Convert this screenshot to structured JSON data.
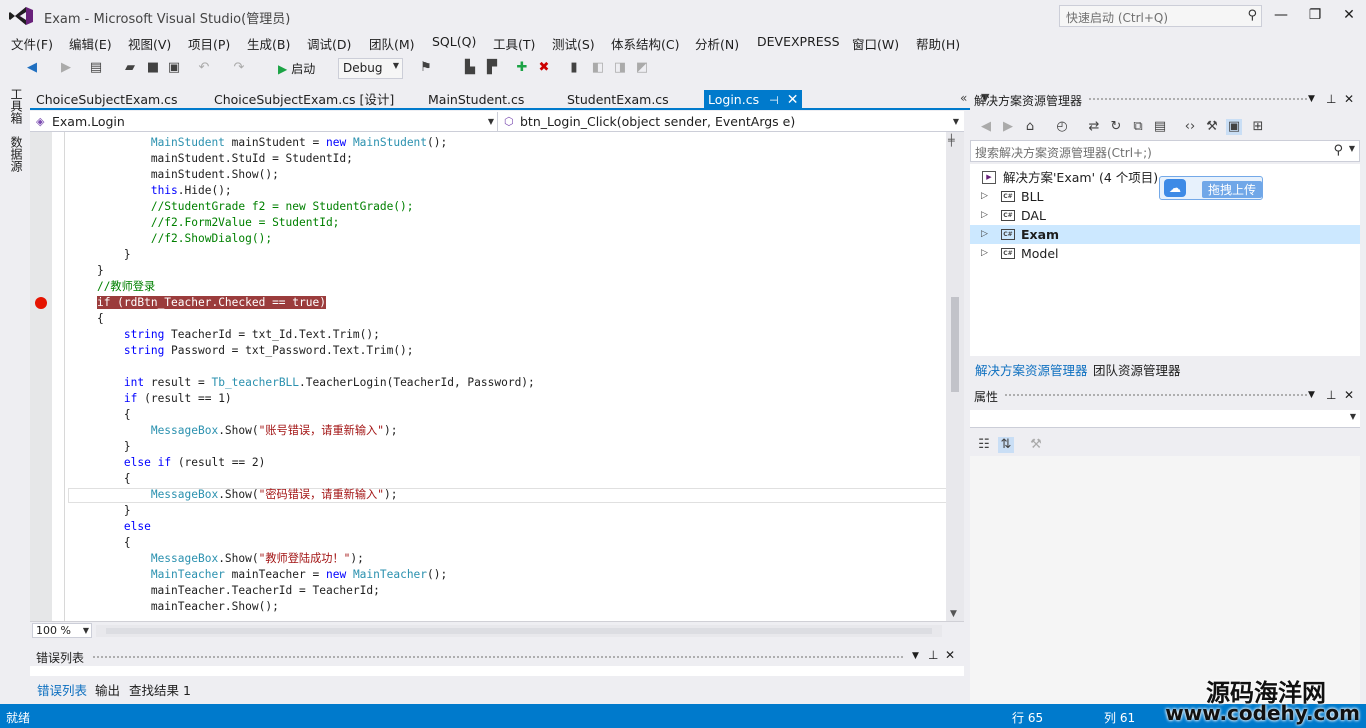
{
  "window": {
    "title": "Exam - Microsoft Visual Studio(管理员)",
    "quick_launch_placeholder": "快速启动 (Ctrl+Q)",
    "minimize": "—",
    "maximize": "❐",
    "close": "✕"
  },
  "menu": [
    "文件(F)",
    "编辑(E)",
    "视图(V)",
    "项目(P)",
    "生成(B)",
    "调试(D)",
    "团队(M)",
    "SQL(Q)",
    "工具(T)",
    "测试(S)",
    "体系结构(C)",
    "分析(N)",
    "DEVEXPRESS",
    "窗口(W)",
    "帮助(H)"
  ],
  "toolbar": {
    "start_label": "启动",
    "configuration": "Debug"
  },
  "side_tabs": [
    "工具箱",
    "数据源"
  ],
  "doc_tabs": [
    {
      "label": "ChoiceSubjectExam.cs",
      "active": false
    },
    {
      "label": "ChoiceSubjectExam.cs [设计]",
      "active": false
    },
    {
      "label": "MainStudent.cs",
      "active": false
    },
    {
      "label": "StudentExam.cs",
      "active": false
    },
    {
      "label": "Login.cs",
      "active": true
    }
  ],
  "nav": {
    "class_combo": "Exam.Login",
    "member_combo": "btn_Login_Click(object sender, EventArgs e)"
  },
  "code": [
    [
      {
        "t": "            "
      },
      {
        "t": "MainStudent",
        "c": "ty"
      },
      {
        "t": " mainStudent = "
      },
      {
        "t": "new",
        "c": "kw"
      },
      {
        "t": " "
      },
      {
        "t": "MainStudent",
        "c": "ty"
      },
      {
        "t": "();"
      }
    ],
    [
      {
        "t": "            mainStudent.StuId = StudentId;"
      }
    ],
    [
      {
        "t": "            mainStudent.Show();"
      }
    ],
    [
      {
        "t": "            "
      },
      {
        "t": "this",
        "c": "kw"
      },
      {
        "t": ".Hide();"
      }
    ],
    [
      {
        "t": "            "
      },
      {
        "t": "//StudentGrade f2 = new StudentGrade();",
        "c": "cm"
      }
    ],
    [
      {
        "t": "            "
      },
      {
        "t": "//f2.Form2Value = StudentId;",
        "c": "cm"
      }
    ],
    [
      {
        "t": "            "
      },
      {
        "t": "//f2.ShowDialog();",
        "c": "cm"
      }
    ],
    [
      {
        "t": "        }"
      }
    ],
    [
      {
        "t": "    }"
      }
    ],
    [
      {
        "t": "    "
      },
      {
        "t": "//教师登录",
        "c": "cm"
      }
    ],
    [
      {
        "t": "    "
      },
      {
        "t": "if (rdBtn_Teacher.Checked == true)",
        "c": "bp-hl"
      }
    ],
    [
      {
        "t": "    {"
      }
    ],
    [
      {
        "t": "        "
      },
      {
        "t": "string",
        "c": "kw"
      },
      {
        "t": " TeacherId = txt_Id.Text.Trim();"
      }
    ],
    [
      {
        "t": "        "
      },
      {
        "t": "string",
        "c": "kw"
      },
      {
        "t": " Password = txt_Password.Text.Trim();"
      }
    ],
    [
      {
        "t": ""
      }
    ],
    [
      {
        "t": "        "
      },
      {
        "t": "int",
        "c": "kw"
      },
      {
        "t": " result = "
      },
      {
        "t": "Tb_teacherBLL",
        "c": "ty"
      },
      {
        "t": ".TeacherLogin(TeacherId, Password);"
      }
    ],
    [
      {
        "t": "        "
      },
      {
        "t": "if",
        "c": "kw"
      },
      {
        "t": " (result == 1)"
      }
    ],
    [
      {
        "t": "        {"
      }
    ],
    [
      {
        "t": "            "
      },
      {
        "t": "MessageBox",
        "c": "ty"
      },
      {
        "t": ".Show("
      },
      {
        "t": "\"账号错误，请重新输入\"",
        "c": "st"
      },
      {
        "t": ");"
      }
    ],
    [
      {
        "t": "        }"
      }
    ],
    [
      {
        "t": "        "
      },
      {
        "t": "else",
        "c": "kw"
      },
      {
        "t": " "
      },
      {
        "t": "if",
        "c": "kw"
      },
      {
        "t": " (result == 2)"
      }
    ],
    [
      {
        "t": "        {"
      }
    ],
    [
      {
        "t": "            "
      },
      {
        "t": "MessageBox",
        "c": "ty"
      },
      {
        "t": ".Show("
      },
      {
        "t": "\"密码错误，请重新输入\"",
        "c": "st"
      },
      {
        "t": ");"
      }
    ],
    [
      {
        "t": "        }"
      }
    ],
    [
      {
        "t": "        "
      },
      {
        "t": "else",
        "c": "kw"
      }
    ],
    [
      {
        "t": "        {"
      }
    ],
    [
      {
        "t": "            "
      },
      {
        "t": "MessageBox",
        "c": "ty"
      },
      {
        "t": ".Show("
      },
      {
        "t": "\"教师登陆成功！\"",
        "c": "st"
      },
      {
        "t": ");"
      }
    ],
    [
      {
        "t": "            "
      },
      {
        "t": "MainTeacher",
        "c": "ty"
      },
      {
        "t": " mainTeacher = "
      },
      {
        "t": "new",
        "c": "kw"
      },
      {
        "t": " "
      },
      {
        "t": "MainTeacher",
        "c": "ty"
      },
      {
        "t": "();"
      }
    ],
    [
      {
        "t": "            mainTeacher.TeacherId = TeacherId;"
      }
    ],
    [
      {
        "t": "            mainTeacher.Show();"
      }
    ]
  ],
  "zoom": "100 %",
  "error_panel": {
    "title": "错误列表",
    "tabs": [
      "错误列表",
      "输出",
      "查找结果 1"
    ]
  },
  "solution_explorer": {
    "title": "解决方案资源管理器",
    "search_placeholder": "搜索解决方案资源管理器(Ctrl+;)",
    "solution_label": "解决方案'Exam' (4 个项目)",
    "projects": [
      {
        "name": "BLL",
        "selected": false
      },
      {
        "name": "DAL",
        "selected": false
      },
      {
        "name": "Exam",
        "selected": true
      },
      {
        "name": "Model",
        "selected": false
      }
    ],
    "upload_label": "拖拽上传",
    "bottom_tabs": [
      "解决方案资源管理器",
      "团队资源管理器"
    ]
  },
  "properties": {
    "title": "属性"
  },
  "status": {
    "text": "就绪",
    "row": "行 65",
    "col": "列 61"
  },
  "watermark": {
    "cn": "源码海洋网",
    "url": "www.codehy.com"
  },
  "colors": {
    "accent": "#007acc",
    "breakpoint": "#e51400",
    "breakpoint_highlight": "#9b3c3c"
  }
}
